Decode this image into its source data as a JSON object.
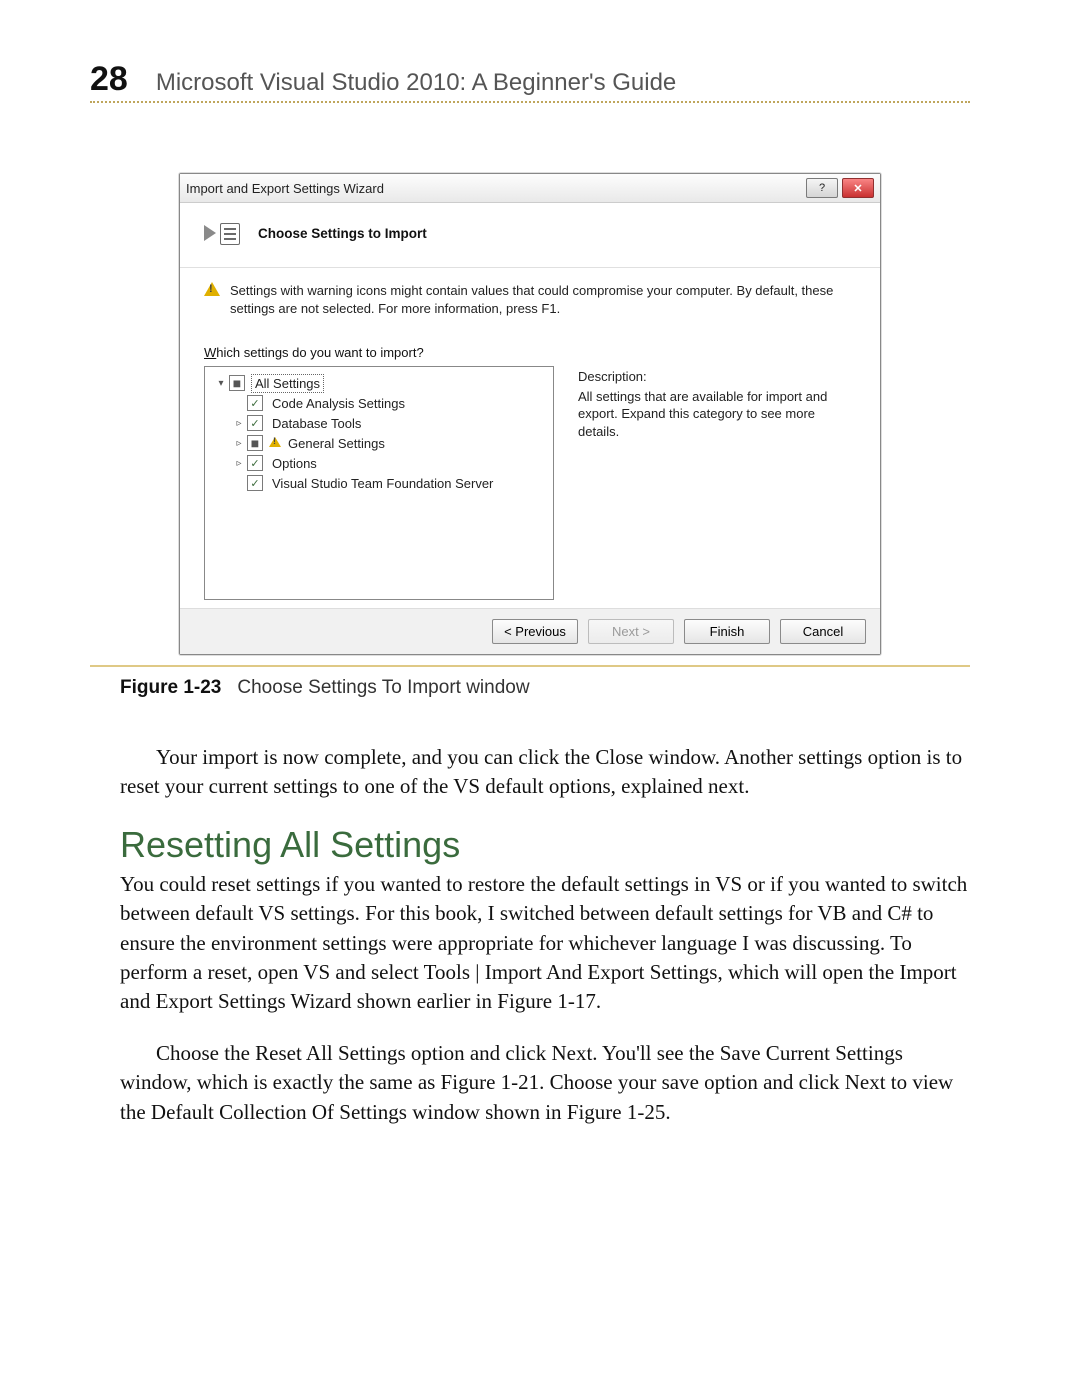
{
  "header": {
    "page_number": "28",
    "book_title": "Microsoft Visual Studio 2010: A Beginner's Guide"
  },
  "dialog": {
    "title": "Import and Export Settings Wizard",
    "titlebar": {
      "help_glyph": "?",
      "close_glyph": "✕"
    },
    "wizard_title": "Choose Settings to Import",
    "warning_text": "Settings with warning icons might contain values that could compromise your computer. By default, these settings are not selected. For more information, press F1.",
    "section_label_pre": "W",
    "section_label_rest": "hich settings do you want to import?",
    "tree": {
      "items": [
        {
          "level": 1,
          "expander": "▾",
          "check": "mixed",
          "warn": false,
          "label": "All Settings",
          "selected": true
        },
        {
          "level": 2,
          "expander": "",
          "check": "✓",
          "warn": false,
          "label": "Code Analysis Settings"
        },
        {
          "level": 2,
          "expander": "▹",
          "check": "✓",
          "warn": false,
          "label": "Database Tools"
        },
        {
          "level": 2,
          "expander": "▹",
          "check": "mixed",
          "warn": true,
          "label": "General Settings"
        },
        {
          "level": 2,
          "expander": "▹",
          "check": "✓",
          "warn": false,
          "label": "Options"
        },
        {
          "level": 2,
          "expander": "",
          "check": "✓",
          "warn": false,
          "label": "Visual Studio Team Foundation Server"
        }
      ]
    },
    "description_title": "Description:",
    "description_body": "All settings that are available for import and export. Expand this category to see more details.",
    "buttons": {
      "previous": "< Previous",
      "next": "Next >",
      "finish": "Finish",
      "cancel": "Cancel"
    }
  },
  "figure": {
    "label": "Figure 1-23",
    "caption": "Choose Settings To Import window"
  },
  "body": {
    "p1": "Your import is now complete, and you can click the Close window. Another settings option is to reset your current settings to one of the VS default options, explained next.",
    "heading": "Resetting All Settings",
    "p2": "You could reset settings if you wanted to restore the default settings in VS or if you wanted to switch between default VS settings. For this book, I switched between default settings for VB and C# to ensure the environment settings were appropriate for whichever language I was discussing. To perform a reset, open VS and select Tools | Import And Export Settings, which will open the Import and Export Settings Wizard shown earlier in Figure 1-17.",
    "p3": "Choose the Reset All Settings option and click Next. You'll see the Save Current Settings window, which is exactly the same as Figure 1-21. Choose your save option and click Next to view the Default Collection Of Settings window shown in Figure 1-25."
  }
}
